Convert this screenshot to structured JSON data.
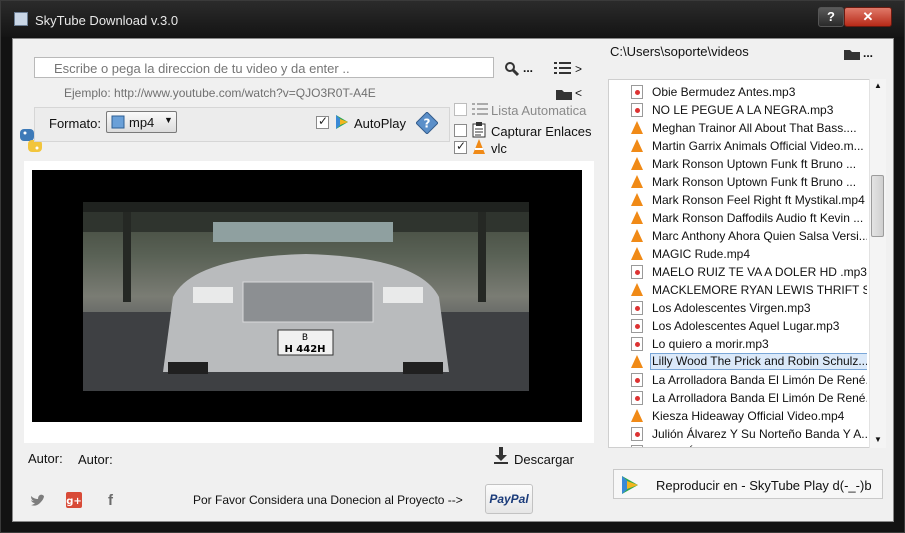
{
  "window": {
    "title": "SkyTube Download v.3.0",
    "help_label": "?",
    "close_label": "✕"
  },
  "search": {
    "placeholder": "Escribe o pega la direccion de tu video y da enter ..",
    "example": "Ejemplo:  http://www.youtube.com/watch?v=QJO3R0T-A4E",
    "dots": "...",
    "list_arrow": ">",
    "folder_arrow": "<"
  },
  "format": {
    "label": "Formato:",
    "value": "mp4",
    "autoplay_label": "AutoPlay",
    "autoplay_checked": true
  },
  "options": [
    {
      "label": "Lista Automatica",
      "checked": false,
      "enabled": false
    },
    {
      "label": "Capturar Enlaces",
      "checked": false,
      "enabled": true
    },
    {
      "label": "vlc",
      "checked": true,
      "enabled": true
    }
  ],
  "video": {
    "plate": "B\nH 442H"
  },
  "author": {
    "label1": "Autor:",
    "label2": "Autor:"
  },
  "download_label": "Descargar",
  "donation_text": "Por Favor Considera una Donecion al Proyecto -->",
  "paypal_label": "PayPal",
  "right": {
    "path": "C:\\Users\\soporte\\videos",
    "dots": "..."
  },
  "files": [
    {
      "name": "Obie Bermudez  Antes.mp3",
      "type": "mp3"
    },
    {
      "name": "NO LE PEGUE A LA NEGRA.mp3",
      "type": "mp3"
    },
    {
      "name": "Meghan Trainor  All About That Bass....",
      "type": "vlc"
    },
    {
      "name": "Martin Garrix  Animals Official Video.m...",
      "type": "vlc"
    },
    {
      "name": "Mark Ronson  Uptown Funk ft Bruno ...",
      "type": "vlc"
    },
    {
      "name": "Mark Ronson  Uptown Funk ft Bruno ...",
      "type": "vlc"
    },
    {
      "name": "Mark Ronson  Feel Right ft Mystikal.mp4",
      "type": "vlc"
    },
    {
      "name": "Mark Ronson  Daffodils Audio ft Kevin ...",
      "type": "vlc"
    },
    {
      "name": "Marc Anthony  Ahora Quien Salsa Versi...",
      "type": "vlc"
    },
    {
      "name": "MAGIC  Rude.mp4",
      "type": "vlc"
    },
    {
      "name": "MAELO RUIZ  TE VA A DOLER   HD .mp3",
      "type": "mp3"
    },
    {
      "name": "MACKLEMORE  RYAN LEWIS  THRIFT S...",
      "type": "vlc"
    },
    {
      "name": "Los Adolescentes  Virgen.mp3",
      "type": "mp3"
    },
    {
      "name": "Los Adolescentes Aquel Lugar.mp3",
      "type": "mp3"
    },
    {
      "name": "Lo quiero a morir.mp3",
      "type": "mp3"
    },
    {
      "name": "Lilly Wood  The Prick and Robin Schulz...",
      "type": "vlc",
      "selected": true
    },
    {
      "name": "La Arrolladora Banda El Limón De René...",
      "type": "mp3"
    },
    {
      "name": "La Arrolladora Banda El Limón De René...",
      "type": "mp3"
    },
    {
      "name": "Kiesza  Hideaway Official Video.mp4",
      "type": "vlc"
    },
    {
      "name": "Julión Álvarez Y Su Norteño Banda  Y A...",
      "type": "mp3"
    },
    {
      "name": "Julión Álvarez Y Su Norteño Banda  Te...",
      "type": "mp3"
    }
  ],
  "play_button": {
    "label": "Reproducir en   -   SkyTube Play d(-_-)b"
  }
}
